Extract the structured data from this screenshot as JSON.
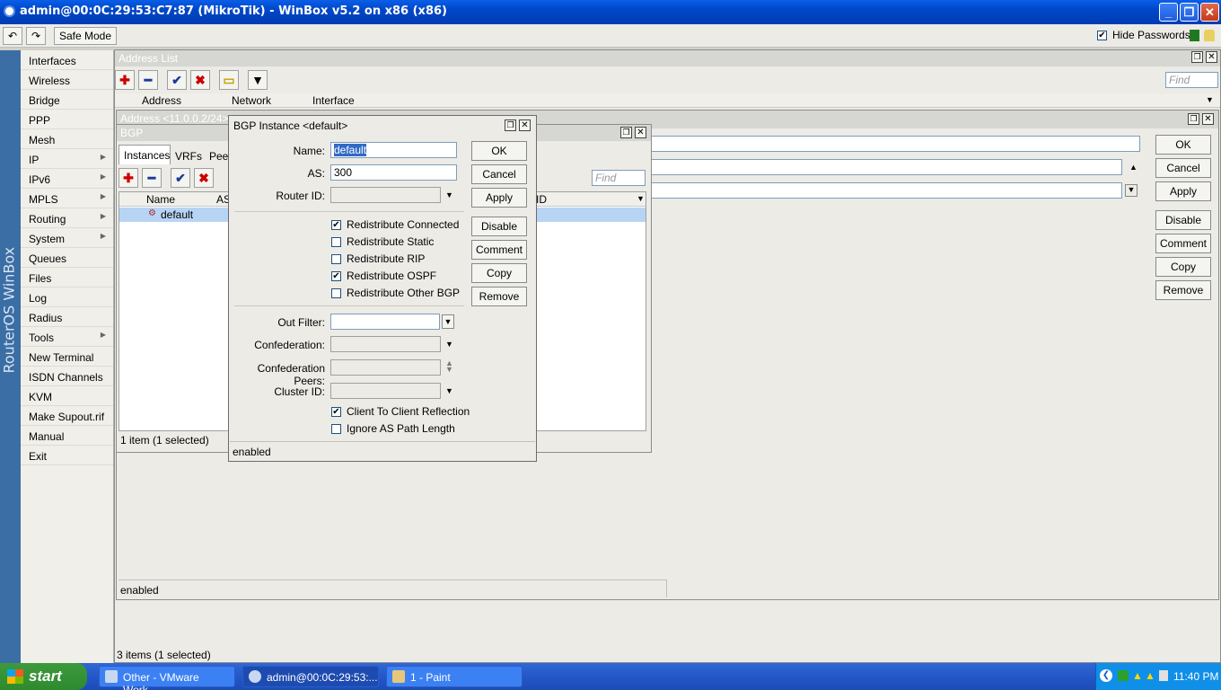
{
  "window": {
    "title": "admin@00:0C:29:53:C7:87 (MikroTik) - WinBox v5.2 on x86 (x86)"
  },
  "toolbar": {
    "undo_icon": "undo-icon",
    "redo_icon": "redo-icon",
    "safe_mode": "Safe Mode",
    "hide_passwords": "Hide Passwords"
  },
  "brand": "RouterOS WinBox",
  "menu": [
    "Interfaces",
    "Wireless",
    "Bridge",
    "PPP",
    "Mesh",
    "IP",
    "IPv6",
    "MPLS",
    "Routing",
    "System",
    "Queues",
    "Files",
    "Log",
    "Radius",
    "Tools",
    "New Terminal",
    "ISDN Channels",
    "KVM",
    "Make Supout.rif",
    "Manual",
    "Exit"
  ],
  "address_list": {
    "title": "Address List",
    "find_placeholder": "Find",
    "columns": [
      "Address",
      "Network",
      "Interface"
    ],
    "status": "3 items (1 selected)"
  },
  "address_dialog": {
    "title_partial": "Address <11.0.0.2/24>",
    "buttons": [
      "OK",
      "Cancel",
      "Apply",
      "Disable",
      "Comment",
      "Copy",
      "Remove"
    ],
    "status": "enabled"
  },
  "bgp": {
    "title": "BGP",
    "tabs": [
      "Instances",
      "VRFs",
      "Peers"
    ],
    "find_placeholder": "Find",
    "columns": [
      "Name",
      "AS",
      "ID"
    ],
    "rows": [
      {
        "name": "default"
      }
    ],
    "status": "1 item (1 selected)"
  },
  "bgp_instance": {
    "title": "BGP Instance <default>",
    "name_label": "Name:",
    "name_value": "default",
    "as_label": "AS:",
    "as_value": "300",
    "router_id_label": "Router ID:",
    "checks": [
      {
        "label": "Redistribute Connected",
        "checked": "✔"
      },
      {
        "label": "Redistribute Static",
        "checked": ""
      },
      {
        "label": "Redistribute RIP",
        "checked": ""
      },
      {
        "label": "Redistribute OSPF",
        "checked": "✔"
      },
      {
        "label": "Redistribute Other BGP",
        "checked": ""
      }
    ],
    "out_filter_label": "Out Filter:",
    "confederation_label": "Confederation:",
    "confederation_peers_label": "Confederation Peers:",
    "cluster_id_label": "Cluster ID:",
    "checks2": [
      {
        "label": "Client To Client Reflection",
        "checked": "✔"
      },
      {
        "label": "Ignore AS Path Length",
        "checked": ""
      }
    ],
    "buttons": [
      "OK",
      "Cancel",
      "Apply",
      "Disable",
      "Comment",
      "Copy",
      "Remove"
    ],
    "status": "enabled"
  },
  "taskbar": {
    "start": "start",
    "tasks": [
      "Other - VMware Work...",
      "admin@00:0C:29:53:...",
      "1 - Paint"
    ],
    "clock": "11:40 PM"
  }
}
